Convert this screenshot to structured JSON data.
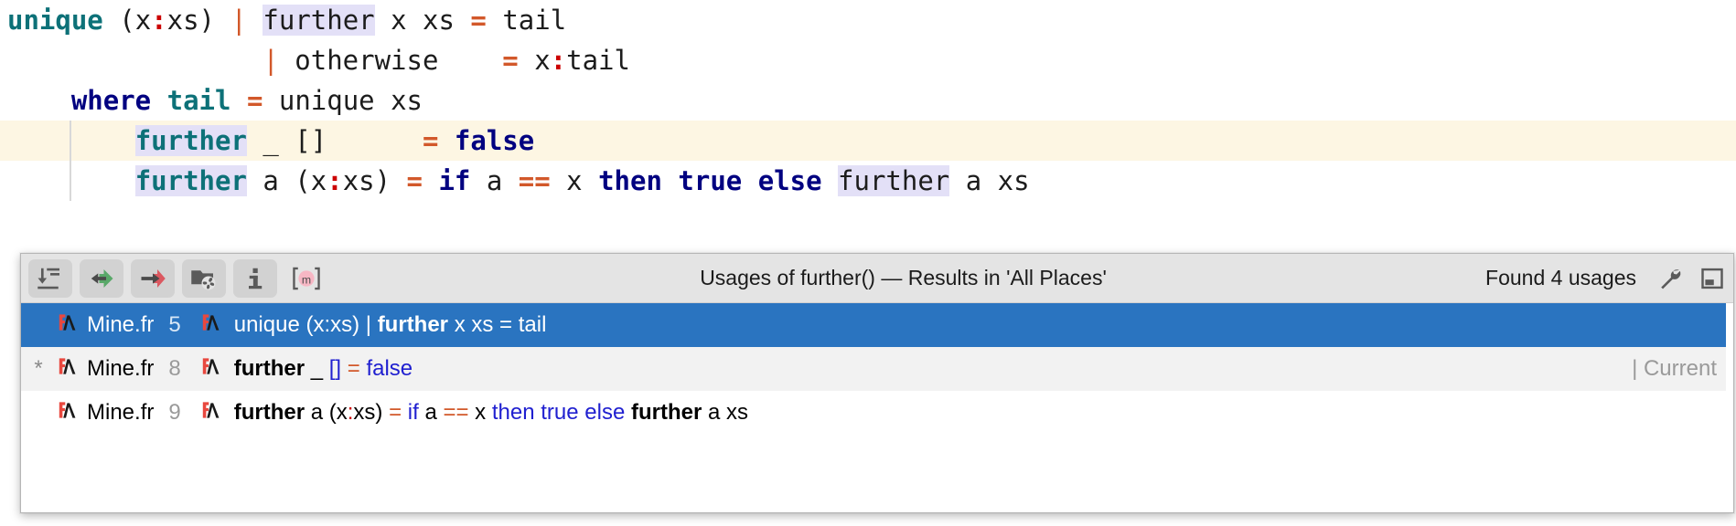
{
  "editor": {
    "lines": [
      {
        "id": "line-unique",
        "caret": false,
        "indent_guide": false,
        "tokens": [
          {
            "t": "unique",
            "c": "fn"
          },
          {
            "t": " ",
            "c": "plain"
          },
          {
            "t": "(x",
            "c": "plain"
          },
          {
            "t": ":",
            "c": "colon"
          },
          {
            "t": "xs) ",
            "c": "plain"
          },
          {
            "t": "|",
            "c": "pipe"
          },
          {
            "t": " ",
            "c": "plain"
          },
          {
            "t": "further",
            "c": "plain hl"
          },
          {
            "t": " x xs ",
            "c": "plain"
          },
          {
            "t": "=",
            "c": "op"
          },
          {
            "t": " tail",
            "c": "plain"
          }
        ]
      },
      {
        "id": "line-otherwise",
        "caret": false,
        "indent_guide": false,
        "tokens": [
          {
            "t": "                ",
            "c": "plain"
          },
          {
            "t": "|",
            "c": "pipe"
          },
          {
            "t": " otherwise    ",
            "c": "plain"
          },
          {
            "t": "=",
            "c": "op"
          },
          {
            "t": " x",
            "c": "plain"
          },
          {
            "t": ":",
            "c": "colon"
          },
          {
            "t": "tail",
            "c": "plain"
          }
        ]
      },
      {
        "id": "line-where",
        "caret": false,
        "indent_guide": false,
        "tokens": [
          {
            "t": "    ",
            "c": "plain"
          },
          {
            "t": "where",
            "c": "kw"
          },
          {
            "t": " ",
            "c": "plain"
          },
          {
            "t": "tail",
            "c": "fn"
          },
          {
            "t": " ",
            "c": "plain"
          },
          {
            "t": "=",
            "c": "op"
          },
          {
            "t": " unique xs",
            "c": "plain"
          }
        ]
      },
      {
        "id": "line-further-nil",
        "caret": true,
        "indent_guide": true,
        "tokens": [
          {
            "t": "        ",
            "c": "plain"
          },
          {
            "t": "further",
            "c": "fn hl"
          },
          {
            "t": " _ [] ",
            "c": "plain"
          },
          {
            "t": "     ",
            "c": "plain"
          },
          {
            "t": "=",
            "c": "op"
          },
          {
            "t": " ",
            "c": "plain"
          },
          {
            "t": "false",
            "c": "kw"
          }
        ]
      },
      {
        "id": "line-further-cons",
        "caret": false,
        "indent_guide": true,
        "tokens": [
          {
            "t": "        ",
            "c": "plain"
          },
          {
            "t": "further",
            "c": "fn hl"
          },
          {
            "t": " a (x",
            "c": "plain"
          },
          {
            "t": ":",
            "c": "colon"
          },
          {
            "t": "xs) ",
            "c": "plain"
          },
          {
            "t": "=",
            "c": "op"
          },
          {
            "t": " ",
            "c": "plain"
          },
          {
            "t": "if",
            "c": "kw"
          },
          {
            "t": " a ",
            "c": "plain"
          },
          {
            "t": "==",
            "c": "op"
          },
          {
            "t": " x ",
            "c": "plain"
          },
          {
            "t": "then",
            "c": "kw"
          },
          {
            "t": " ",
            "c": "plain"
          },
          {
            "t": "true",
            "c": "kw"
          },
          {
            "t": " ",
            "c": "plain"
          },
          {
            "t": "else",
            "c": "kw"
          },
          {
            "t": " ",
            "c": "plain"
          },
          {
            "t": "further",
            "c": "plain hl"
          },
          {
            "t": " a xs",
            "c": "plain"
          }
        ]
      }
    ]
  },
  "usages": {
    "title": "Usages of further() — Results in 'All Places'",
    "count_label": "Found 4 usages",
    "toolbar": [
      {
        "name": "expand-all-icon",
        "label": "Expand All"
      },
      {
        "name": "previous-occurrence-icon",
        "label": "Previous Occurrence"
      },
      {
        "name": "next-occurrence-icon",
        "label": "Next Occurrence"
      },
      {
        "name": "group-by-file-structure-icon",
        "label": "Group by File Structure"
      },
      {
        "name": "info-icon",
        "label": "Show Usage Preview"
      },
      {
        "name": "merge-usages-icon",
        "label": "Merge Duplicates"
      }
    ],
    "toolbar_right": [
      {
        "name": "settings-wrench-icon",
        "label": "Settings"
      },
      {
        "name": "hide-panel-icon",
        "label": "Hide"
      }
    ],
    "colors": {
      "selection": "#2a74c0",
      "toolbar_bg": "#e4e4e4",
      "alt_row": "#f2f2f2",
      "caret_row": "#fdf6e3",
      "identifier_highlight": "#e3e0f7",
      "keyword": "#000080",
      "function": "#0d7178",
      "operator": "#d2582a"
    },
    "rows": [
      {
        "id": "usage-row-1",
        "mark": "",
        "file": "Mine.fr",
        "line": "5",
        "selected": true,
        "alt": false,
        "right": "",
        "snippet": [
          {
            "t": "unique (x:xs) | ",
            "c": ""
          },
          {
            "t": "further",
            "c": "b"
          },
          {
            "t": " x xs = tail",
            "c": ""
          }
        ]
      },
      {
        "id": "usage-row-2",
        "mark": "*",
        "file": "Mine.fr",
        "line": "8",
        "selected": false,
        "alt": true,
        "right": "| Current",
        "snippet": [
          {
            "t": "further",
            "c": "b"
          },
          {
            "t": " _ ",
            "c": ""
          },
          {
            "t": "[]",
            "c": "s-br"
          },
          {
            "t": "    ",
            "c": ""
          },
          {
            "t": "=",
            "c": "s-op"
          },
          {
            "t": " ",
            "c": ""
          },
          {
            "t": "false",
            "c": "s-kw"
          }
        ]
      },
      {
        "id": "usage-row-3",
        "mark": "",
        "file": "Mine.fr",
        "line": "9",
        "selected": false,
        "alt": false,
        "right": "",
        "snippet": [
          {
            "t": "further",
            "c": "b"
          },
          {
            "t": " a (x",
            "c": ""
          },
          {
            "t": ":",
            "c": "s-colon"
          },
          {
            "t": "xs) ",
            "c": ""
          },
          {
            "t": "=",
            "c": "s-op"
          },
          {
            "t": " ",
            "c": ""
          },
          {
            "t": "if",
            "c": "s-kw"
          },
          {
            "t": " a ",
            "c": ""
          },
          {
            "t": "==",
            "c": "s-op"
          },
          {
            "t": " x ",
            "c": ""
          },
          {
            "t": "then",
            "c": "s-kw"
          },
          {
            "t": " ",
            "c": ""
          },
          {
            "t": "true",
            "c": "s-kw"
          },
          {
            "t": " ",
            "c": ""
          },
          {
            "t": "else",
            "c": "s-kw"
          },
          {
            "t": " ",
            "c": ""
          },
          {
            "t": "further",
            "c": "b"
          },
          {
            "t": " a xs",
            "c": ""
          }
        ]
      }
    ]
  }
}
